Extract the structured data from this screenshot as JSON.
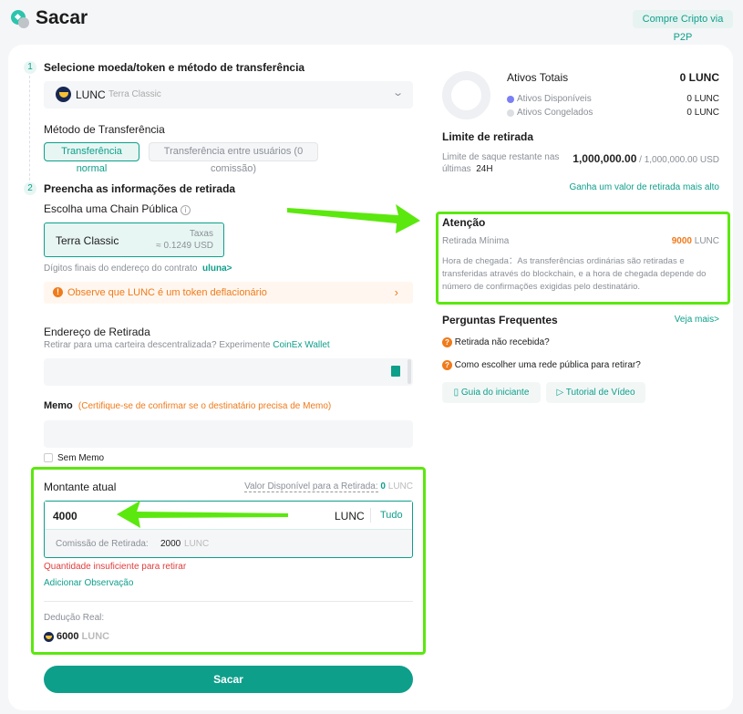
{
  "header": {
    "title": "Sacar",
    "p2p_button": "Compre Cripto via P2P"
  },
  "step1": {
    "number": "1",
    "title": "Selecione moeda/token e método de transferência",
    "coin": "LUNC",
    "coin_name": "Terra Classic",
    "method_label": "Método de Transferência",
    "methods": [
      "Transferência normal",
      "Transferência entre usuários (0 comissão)"
    ]
  },
  "step2": {
    "number": "2",
    "title": "Preencha as informações de retirada",
    "chain_label": "Escolha uma Chain Pública",
    "chain": {
      "name": "Terra Classic",
      "fee_label": "Taxas",
      "fee": "≈ 0.1249 USD"
    },
    "contract_label": "Dígitos finais do endereço do contrato",
    "contract_link": "uluna>",
    "notice": "Observe que LUNC é um token deflacionário"
  },
  "address": {
    "label": "Endereço de Retirada",
    "hint": "Retirar para uma carteira descentralizada? Experimente",
    "hint_link": "CoinEx Wallet",
    "value": ""
  },
  "memo": {
    "label": "Memo",
    "hint": "(Certifique-se de confirmar se o destinatário precisa de Memo)",
    "value": "",
    "no_memo": "Sem Memo"
  },
  "amount": {
    "label": "Montante atual",
    "available_label": "Valor Disponível para a Retirada:",
    "available_value": "0",
    "available_unit": "LUNC",
    "value": "4000",
    "unit": "LUNC",
    "all": "Tudo",
    "fee_label": "Comissão de Retirada:",
    "fee_value": "2000",
    "fee_unit": "LUNC",
    "error": "Quantidade insuficiente para retirar",
    "add_note": "Adicionar Observação",
    "deduction_label": "Dedução Real:",
    "deduction_value": "6000",
    "deduction_unit": "LUNC"
  },
  "submit": "Sacar",
  "assets": {
    "title": "Ativos Totais",
    "total": "0 LUNC",
    "available_label": "Ativos Disponíveis",
    "available": "0 LUNC",
    "frozen_label": "Ativos Congelados",
    "frozen": "0 LUNC"
  },
  "limit": {
    "title": "Limite de retirada",
    "desc": "Limite de saque restante nas últimas",
    "period": "24H",
    "remaining": "1,000,000.00",
    "sep": "/",
    "max": "1,000,000.00 USD",
    "link": "Ganha um valor de retirada mais alto"
  },
  "attention": {
    "title": "Atenção",
    "min_label": "Retirada Mínima",
    "min_value": "9000",
    "min_unit": "LUNC",
    "arrival": "Hora de chegada：As transferências ordinárias são retiradas e transferidas através do blockchain, e a hora de chegada depende do número de confirmações exigidas pelo destinatário."
  },
  "faq": {
    "title": "Perguntas Frequentes",
    "more": "Veja mais>",
    "items": [
      "Retirada não recebida?",
      "Como escolher uma rede pública para retirar?"
    ],
    "guide": "Guia do iniciante",
    "video": "Tutorial de Vídeo"
  },
  "colors": {
    "accent": "#0e9f8b",
    "warning": "#f07a1a",
    "error": "#e03c3c",
    "annotation": "#5be80e"
  }
}
